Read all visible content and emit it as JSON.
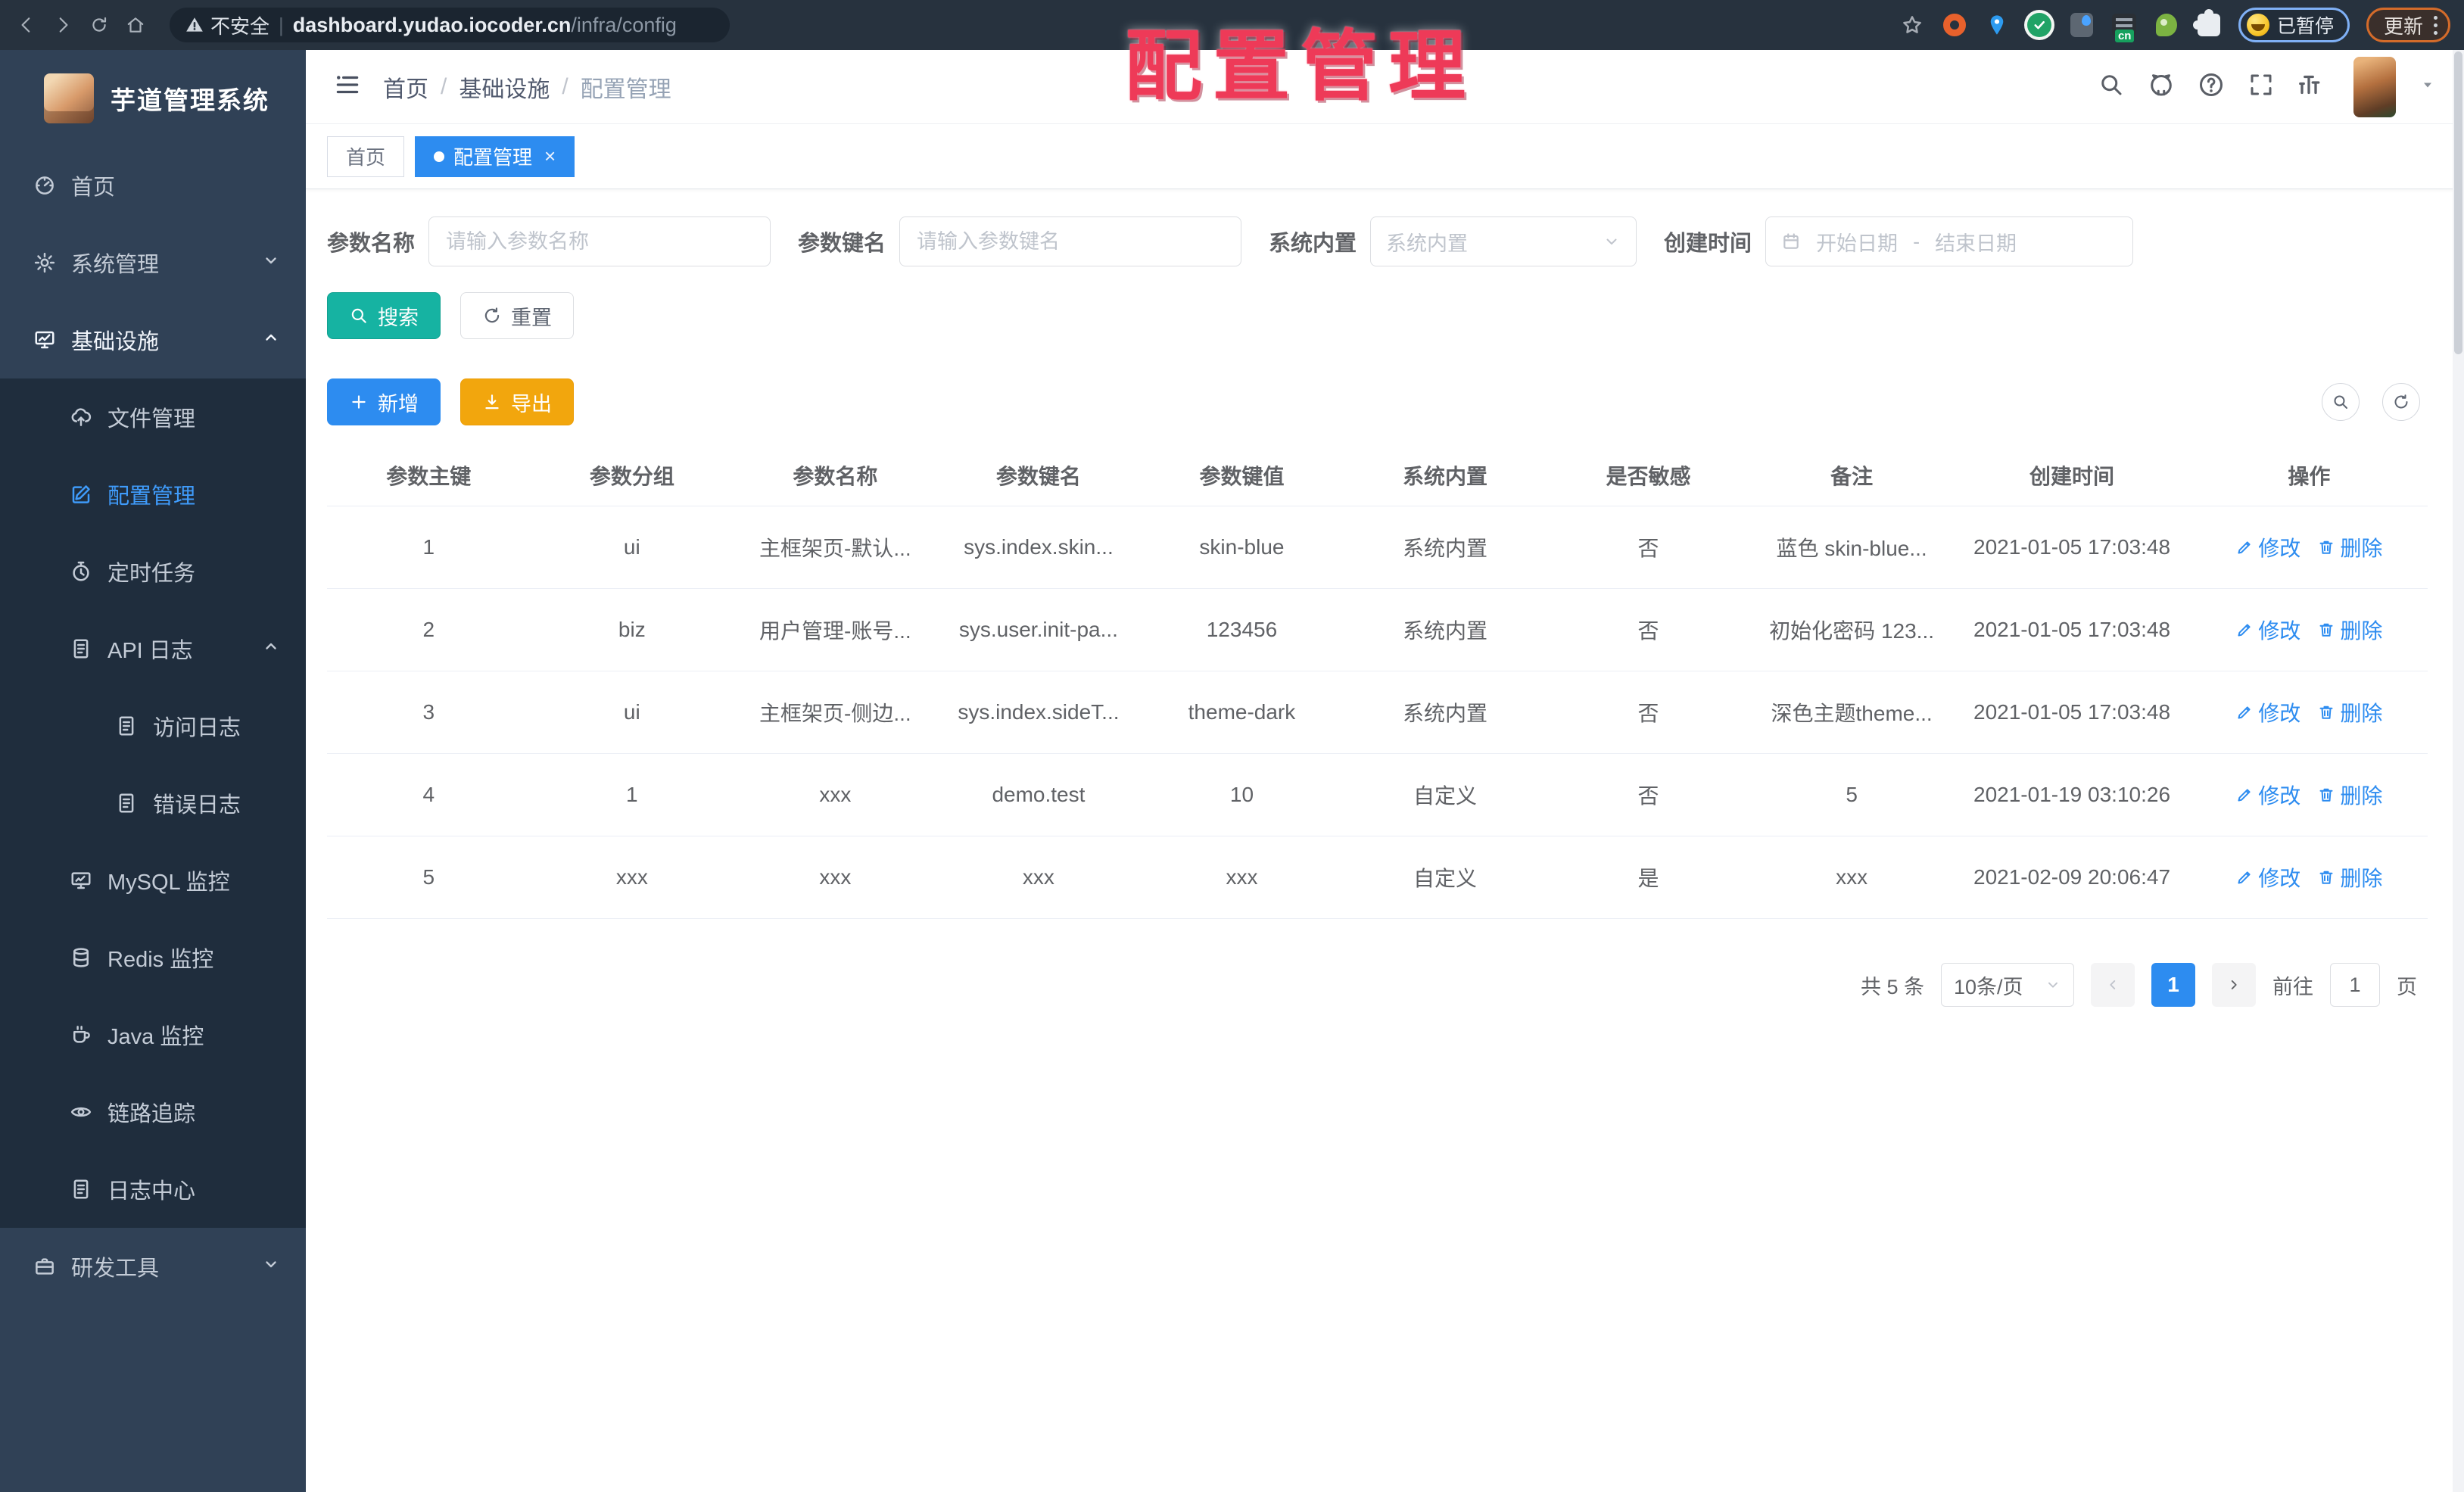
{
  "browser": {
    "security_label": "不安全",
    "url_host": "dashboard.yudao.iocoder.cn",
    "url_path": "/infra/config",
    "paused_badge": "已暂停",
    "update_button": "更新"
  },
  "annotation": {
    "title": "配置管理"
  },
  "sidebar": {
    "logo_title": "芋道管理系统",
    "items": [
      {
        "label": "首页",
        "icon": "i-dashboard",
        "lv": 1,
        "sub": false,
        "chevron": "",
        "active": false,
        "open": false
      },
      {
        "label": "系统管理",
        "icon": "i-gear",
        "lv": 1,
        "sub": false,
        "chevron": "i-chev-down",
        "active": false,
        "open": false
      },
      {
        "label": "基础设施",
        "icon": "i-screen",
        "lv": 1,
        "sub": false,
        "chevron": "i-chev-up",
        "active": false,
        "open": true
      },
      {
        "label": "文件管理",
        "icon": "i-cloud-up",
        "lv": 2,
        "sub": true,
        "chevron": "",
        "active": false,
        "open": false
      },
      {
        "label": "配置管理",
        "icon": "i-edit-sq",
        "lv": 2,
        "sub": true,
        "chevron": "",
        "active": true,
        "open": false
      },
      {
        "label": "定时任务",
        "icon": "i-timer",
        "lv": 2,
        "sub": true,
        "chevron": "",
        "active": false,
        "open": false
      },
      {
        "label": "API 日志",
        "icon": "i-doc",
        "lv": 2,
        "sub": true,
        "chevron": "i-chev-up",
        "active": false,
        "open": false
      },
      {
        "label": "访问日志",
        "icon": "i-doc",
        "lv": 3,
        "sub": true,
        "chevron": "",
        "active": false,
        "open": false
      },
      {
        "label": "错误日志",
        "icon": "i-doc",
        "lv": 3,
        "sub": true,
        "chevron": "",
        "active": false,
        "open": false
      },
      {
        "label": "MySQL 监控",
        "icon": "i-monitor",
        "lv": 2,
        "sub": true,
        "chevron": "",
        "active": false,
        "open": false
      },
      {
        "label": "Redis 监控",
        "icon": "i-db",
        "lv": 2,
        "sub": true,
        "chevron": "",
        "active": false,
        "open": false
      },
      {
        "label": "Java 监控",
        "icon": "i-coffee",
        "lv": 2,
        "sub": true,
        "chevron": "",
        "active": false,
        "open": false
      },
      {
        "label": "链路追踪",
        "icon": "i-eye",
        "lv": 2,
        "sub": true,
        "chevron": "",
        "active": false,
        "open": false
      },
      {
        "label": "日志中心",
        "icon": "i-doc",
        "lv": 2,
        "sub": true,
        "chevron": "",
        "active": false,
        "open": false
      },
      {
        "label": "研发工具",
        "icon": "i-case",
        "lv": 1,
        "sub": false,
        "chevron": "i-chev-down",
        "active": false,
        "open": false
      }
    ]
  },
  "header": {
    "breadcrumb": [
      "首页",
      "基础设施",
      "配置管理"
    ],
    "separator": "/"
  },
  "tabs": [
    {
      "label": "首页"
    },
    {
      "label": "配置管理"
    }
  ],
  "filters": {
    "name_label": "参数名称",
    "name_placeholder": "请输入参数名称",
    "key_label": "参数键名",
    "key_placeholder": "请输入参数键名",
    "type_label": "系统内置",
    "type_placeholder": "系统内置",
    "date_label": "创建时间",
    "date_start": "开始日期",
    "date_separator": "-",
    "date_end": "结束日期",
    "search_label": "搜索",
    "reset_label": "重置",
    "add_label": "新增",
    "export_label": "导出"
  },
  "table": {
    "columns": [
      "参数主键",
      "参数分组",
      "参数名称",
      "参数键名",
      "参数键值",
      "系统内置",
      "是否敏感",
      "备注",
      "创建时间",
      "操作"
    ],
    "rows": [
      [
        "1",
        "ui",
        "主框架页-默认...",
        "sys.index.skin...",
        "skin-blue",
        "系统内置",
        "否",
        "蓝色 skin-blue...",
        "2021-01-05 17:03:48"
      ],
      [
        "2",
        "biz",
        "用户管理-账号...",
        "sys.user.init-pa...",
        "123456",
        "系统内置",
        "否",
        "初始化密码 123...",
        "2021-01-05 17:03:48"
      ],
      [
        "3",
        "ui",
        "主框架页-侧边...",
        "sys.index.sideT...",
        "theme-dark",
        "系统内置",
        "否",
        "深色主题theme...",
        "2021-01-05 17:03:48"
      ],
      [
        "4",
        "1",
        "xxx",
        "demo.test",
        "10",
        "自定义",
        "否",
        "5",
        "2021-01-19 03:10:26"
      ],
      [
        "5",
        "xxx",
        "xxx",
        "xxx",
        "xxx",
        "自定义",
        "是",
        "xxx",
        "2021-02-09 20:06:47"
      ]
    ],
    "edit_label": "修改",
    "delete_label": "删除"
  },
  "pagination": {
    "total": "共 5 条",
    "page_size": "10条/页",
    "current_page": "1",
    "goto_label": "前往",
    "goto_value": "1",
    "page_unit": "页"
  },
  "colors": {
    "primary": "#2d8cf0",
    "success_teal": "#16b3a2",
    "warning": "#f2a60d",
    "sidebar_bg": "#304156",
    "submenu_bg": "#1f2d3d",
    "annotation_red": "#ee3a58"
  }
}
